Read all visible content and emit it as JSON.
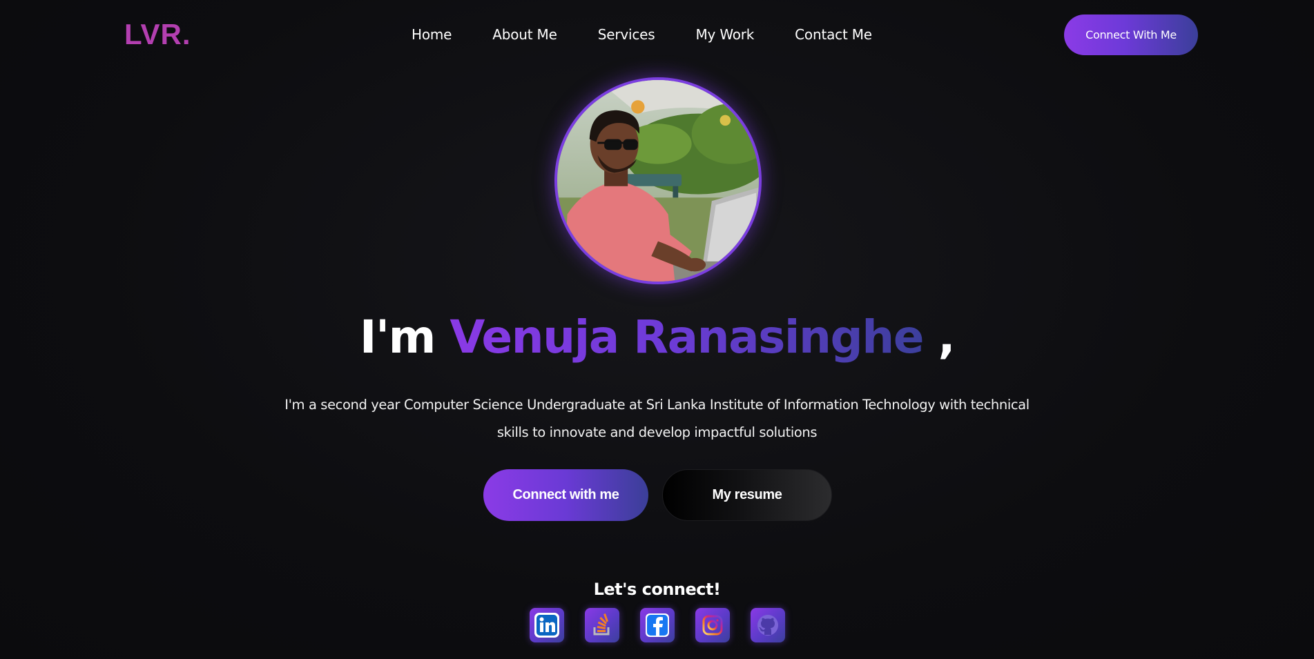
{
  "brand": {
    "logo_text": "LVR."
  },
  "nav": {
    "items": [
      {
        "label": "Home"
      },
      {
        "label": "About Me"
      },
      {
        "label": "Services"
      },
      {
        "label": "My Work"
      },
      {
        "label": "Contact Me"
      }
    ],
    "cta_label": "Connect With Me"
  },
  "hero": {
    "greeting": "I'm ",
    "name": "Venuja Ranasinghe",
    "trailing": " ,",
    "description": "I'm a second year Computer Science Undergraduate at Sri Lanka Institute of Information Technology with technical skills to innovate and develop impactful solutions",
    "primary_button": "Connect with me",
    "secondary_button": "My resume"
  },
  "connect": {
    "title": "Let's connect!",
    "links": [
      {
        "icon": "linkedin-icon"
      },
      {
        "icon": "stackoverflow-icon"
      },
      {
        "icon": "facebook-icon"
      },
      {
        "icon": "instagram-icon"
      },
      {
        "icon": "github-icon"
      }
    ]
  },
  "theme": {
    "accent_start": "#8b3be6",
    "accent_end": "#3b3f9a",
    "logo_color": "#b33fb0",
    "background": "#0e0e11"
  }
}
